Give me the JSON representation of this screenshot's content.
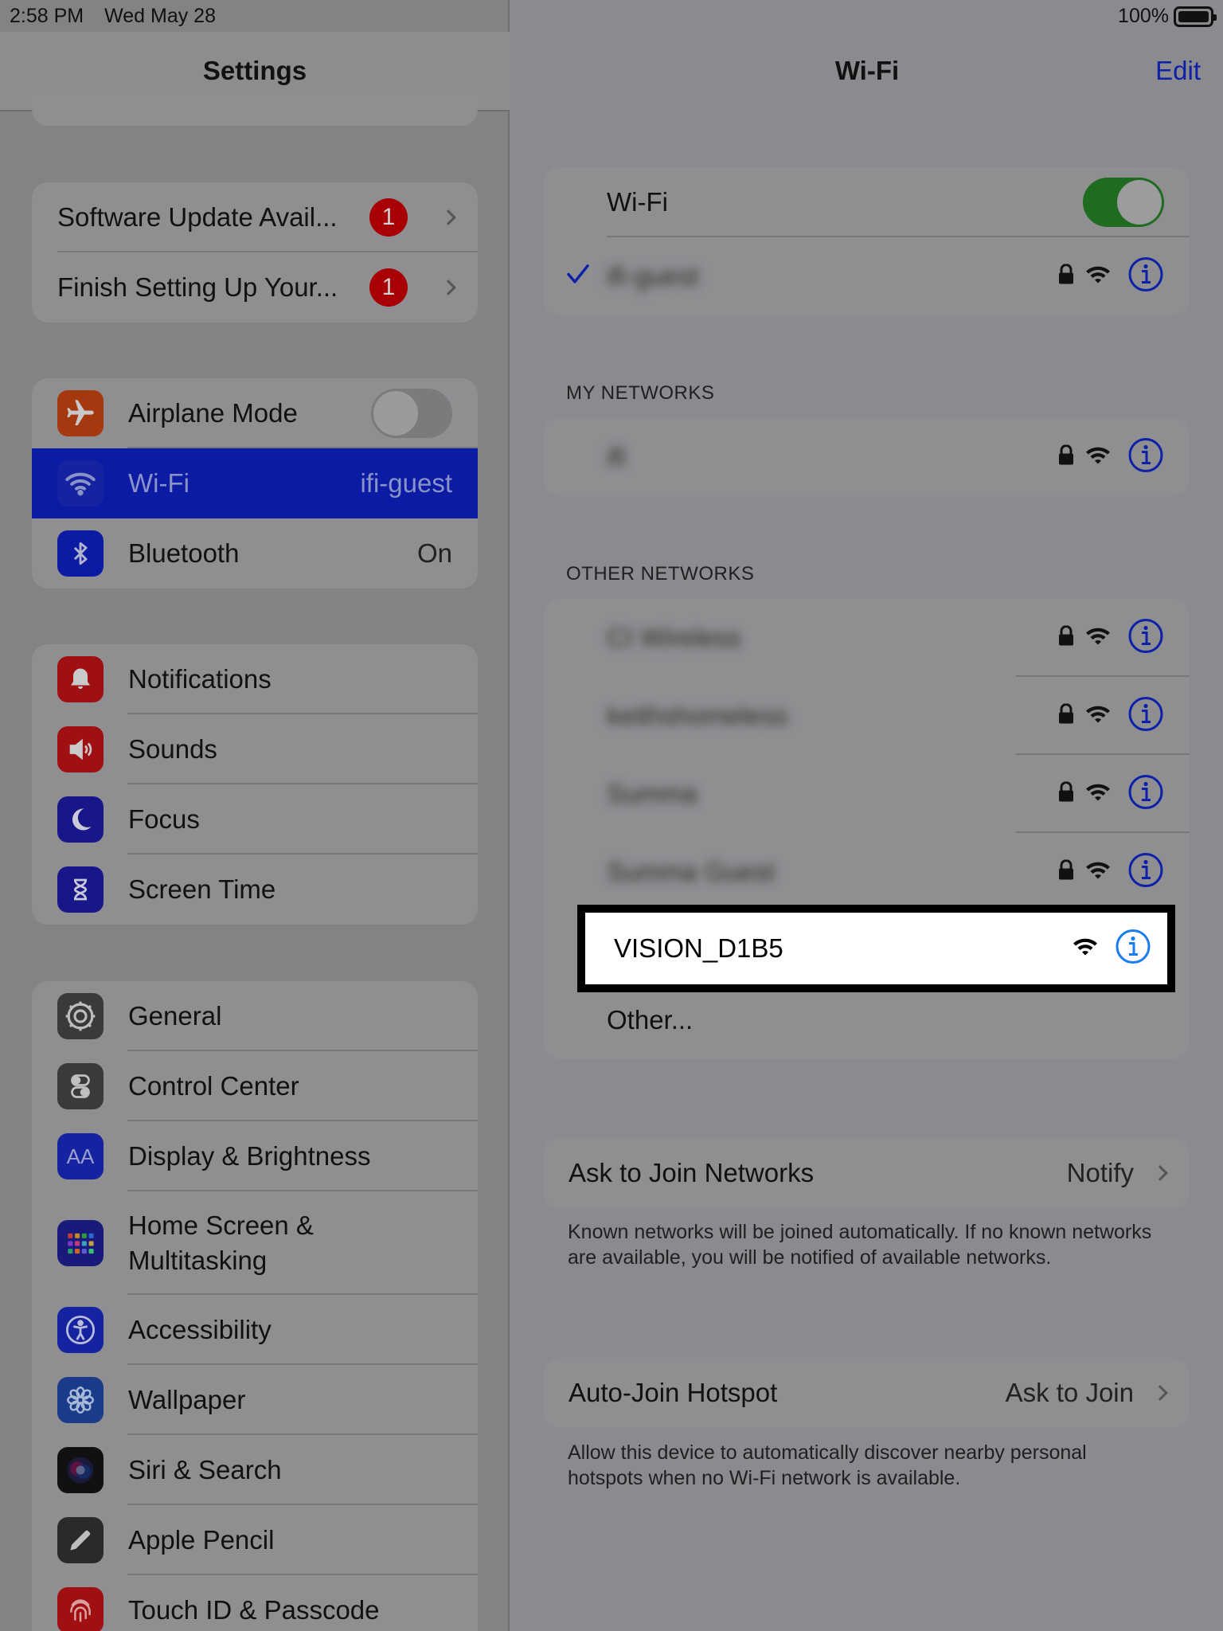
{
  "status_bar": {
    "time": "2:58 PM",
    "date": "Wed May 28",
    "battery": "100%"
  },
  "left": {
    "title": "Settings",
    "alerts": [
      {
        "label": "Software Update Avail...",
        "badge": "1"
      },
      {
        "label": "Finish Setting Up Your...",
        "badge": "1"
      }
    ],
    "connectivity": {
      "airplane": {
        "label": "Airplane Mode",
        "toggle_on": false
      },
      "wifi": {
        "label": "Wi-Fi",
        "value": "ifi-guest"
      },
      "bluetooth": {
        "label": "Bluetooth",
        "value": "On"
      }
    },
    "group2": [
      {
        "label": "Notifications",
        "icon": "bell-icon"
      },
      {
        "label": "Sounds",
        "icon": "speaker-icon"
      },
      {
        "label": "Focus",
        "icon": "moon-icon"
      },
      {
        "label": "Screen Time",
        "icon": "hourglass-icon"
      }
    ],
    "group3": [
      {
        "label": "General",
        "icon": "gear-icon"
      },
      {
        "label": "Control Center",
        "icon": "switches-icon"
      },
      {
        "label": "Display & Brightness",
        "icon": "text-size-icon"
      },
      {
        "label_line1": "Home Screen &",
        "label_line2": "Multitasking",
        "icon": "app-grid-icon"
      },
      {
        "label": "Accessibility",
        "icon": "accessibility-icon"
      },
      {
        "label": "Wallpaper",
        "icon": "flower-icon"
      },
      {
        "label": "Siri & Search",
        "icon": "siri-icon"
      },
      {
        "label": "Apple Pencil",
        "icon": "pencil-icon"
      },
      {
        "label": "Touch ID & Passcode",
        "icon": "fingerprint-icon"
      }
    ],
    "text_size_glyph": "AA"
  },
  "right": {
    "title": "Wi-Fi",
    "edit": "Edit",
    "wifi_toggle": {
      "label": "Wi-Fi",
      "on": true
    },
    "current_network": "ifi-guest",
    "my_networks_header": "MY NETWORKS",
    "my_networks": [
      {
        "name": "ifi"
      }
    ],
    "other_networks_header": "OTHER NETWORKS",
    "other_networks": [
      {
        "name": "CI Wireless",
        "secured": true
      },
      {
        "name": "keithshomeless",
        "secured": true
      },
      {
        "name": "Summa",
        "secured": true
      },
      {
        "name": "Summa Guest",
        "secured": true
      }
    ],
    "highlighted_network": {
      "name": "VISION_D1B5",
      "secured": false
    },
    "other_label": "Other...",
    "ask_to_join": {
      "label": "Ask to Join Networks",
      "value": "Notify"
    },
    "ask_to_join_footnote": "Known networks will be joined automatically. If no known networks are available, you will be notified of available networks.",
    "auto_join": {
      "label": "Auto-Join Hotspot",
      "value": "Ask to Join"
    },
    "auto_join_footnote": "Allow this device to automatically discover nearby personal hotspots when no Wi-Fi network is available."
  },
  "colors": {
    "accent_blue": "#0c20a8",
    "info_blue_bright": "#1a7cf5",
    "badge_red": "#a80004",
    "toggle_green": "#1f6b1f",
    "dimmed_background": "#8a8a8f"
  }
}
